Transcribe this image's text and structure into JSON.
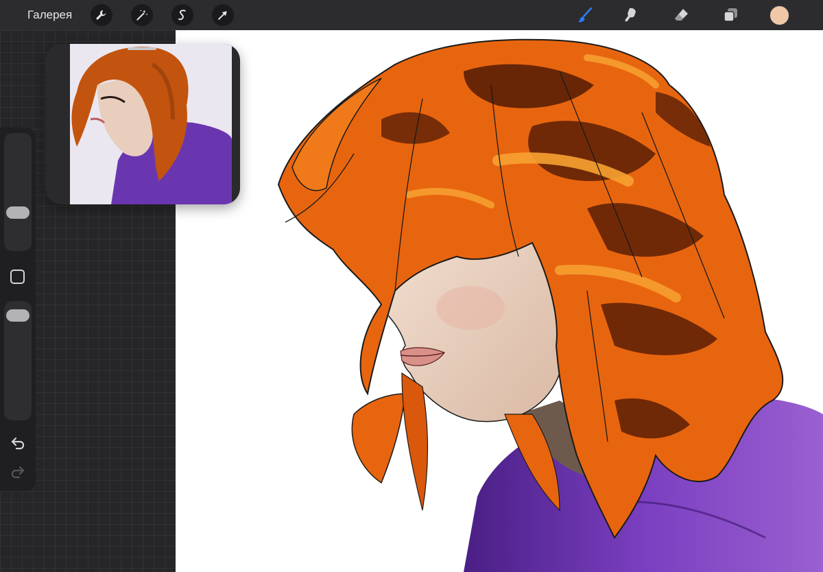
{
  "toolbar": {
    "gallery_label": "Галерея",
    "left_tools": [
      "wrench-icon",
      "magic-wand-icon",
      "selection-s-icon",
      "transform-arrow-icon"
    ],
    "right_tools": [
      "brush-icon",
      "smudge-icon",
      "eraser-icon",
      "layers-icon"
    ],
    "active_tool": "brush-icon",
    "current_color": "#f0c8a8"
  },
  "colors": {
    "toolbar_bg": "#2c2c2e",
    "active_tool_blue": "#2f7cf6",
    "canvas_bg": "#ffffff",
    "hair_orange": "#e8650f",
    "hair_dark": "#5a1f05",
    "skin": "#efd6c3",
    "shirt_purple": "#8a4fc6"
  },
  "sidebar": {
    "brush_size_value": 0.3,
    "opacity_value": 0.06,
    "modify_icon": "square-icon",
    "undo_icon": "undo-icon",
    "redo_icon": "redo-icon"
  },
  "reference": {
    "window_icon": "reference-photo"
  }
}
